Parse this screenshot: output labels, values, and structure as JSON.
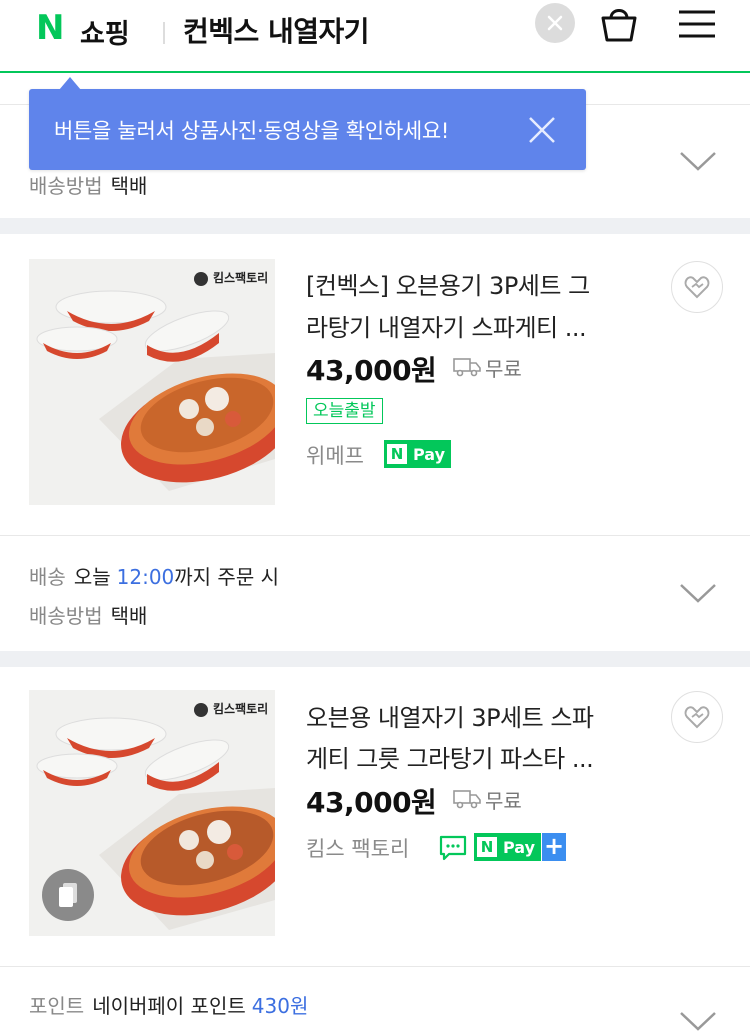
{
  "header": {
    "logo_letter": "N",
    "logo_label": "쇼핑",
    "search_query": "컨벡스 내열자기",
    "accent_color": "#03c75a",
    "icons": [
      "clear-icon",
      "shopping-bag-icon",
      "hamburger-menu-icon"
    ]
  },
  "tooltip": {
    "text": "버튼을 눌러서 상품사진·동영상을 확인하세요!",
    "color": "#5f84eb"
  },
  "top_section": {
    "method_label": "배송방법",
    "method_value": "택배"
  },
  "products": [
    {
      "title_line1": "[컨벡스] 오븐용기 3P세트 그",
      "title_line2": "라탕기 내열자기 스파게티 ...",
      "price": "43,000원",
      "shipping": "무료",
      "badge": "오늘출발",
      "seller": "위메프",
      "pay_badge": "Pay",
      "thumb_logo": "킴스팩토리",
      "delivery_label": "배송",
      "delivery_prefix": "오늘",
      "delivery_time": "12:00",
      "delivery_suffix": "까지 주문 시",
      "method_label": "배송방법",
      "method_value": "택배"
    },
    {
      "title_line1": "오븐용 내열자기 3P세트 스파",
      "title_line2": "게티 그릇 그라탕기 파스타 ...",
      "price": "43,000원",
      "shipping": "무료",
      "seller": "킴스 팩토리",
      "pay_badge": "Pay",
      "pay_plus": "+",
      "thumb_logo": "킴스팩토리"
    }
  ],
  "bottom_section": {
    "point_label": "포인트",
    "point_prefix": "네이버페이 포인트",
    "point_value": "430원"
  }
}
